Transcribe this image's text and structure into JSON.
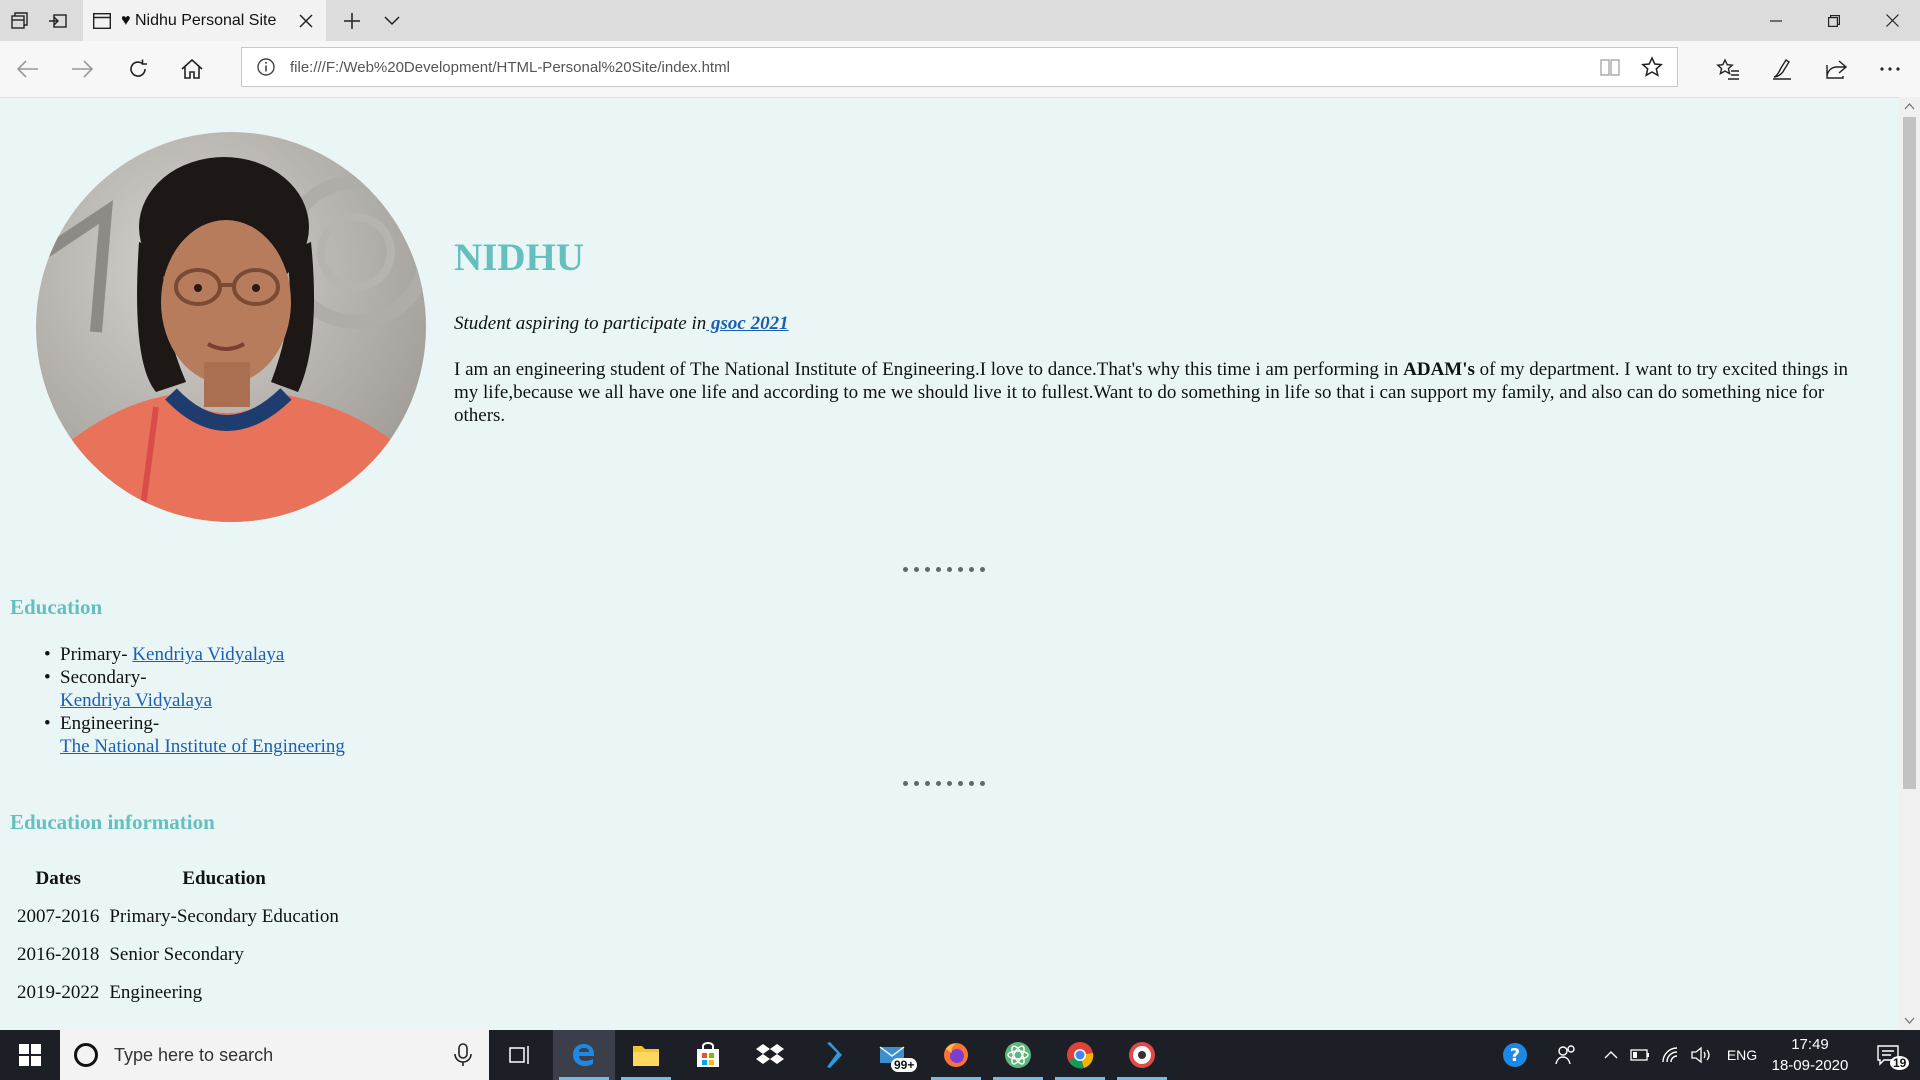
{
  "browser": {
    "tab_title": "Nidhu Personal Site",
    "url": "file:///F:/Web%20Development/HTML-Personal%20Site/index.html"
  },
  "page": {
    "name": "NIDHU",
    "tagline_prefix": "Student aspiring to participate in",
    "tagline_link": " gsoc 2021",
    "bio_before_bold": "I am an engineering student of The National Institute of Engineering.I love to dance.That's why this time i am performing in ",
    "bio_bold": "ADAM's",
    "bio_after_bold": " of my department. I want to try excited things in my life,because we all have one life and according to me we should live it to fullest.Want to do something in life so that i can support my family, and also can do something nice for others.",
    "education_title": "Education",
    "education_items": [
      {
        "prefix": "Primary- ",
        "link": "Kendriya Vidyalaya"
      },
      {
        "prefix": "Secondary-",
        "link": "Kendriya Vidyalaya"
      },
      {
        "prefix": "Engineering-",
        "link": "The National Institute of Engineering"
      }
    ],
    "education_info_title": "Education information",
    "table": {
      "headers": [
        "Dates",
        "Education"
      ],
      "rows": [
        [
          "2007-2016",
          "Primary-Secondary Education"
        ],
        [
          "2016-2018",
          "Senior Secondary"
        ],
        [
          "2019-2022",
          "Engineering"
        ]
      ]
    }
  },
  "taskbar": {
    "search_placeholder": "Type here to search",
    "mail_badge": "99+",
    "language": "ENG",
    "time": "17:49",
    "date": "18-09-2020",
    "notification_count": "19"
  },
  "colors": {
    "page_background": "#eaf6f6",
    "heading": "#66bfbf",
    "link": "#1a5fb4",
    "taskbar": "#1c1f26"
  }
}
